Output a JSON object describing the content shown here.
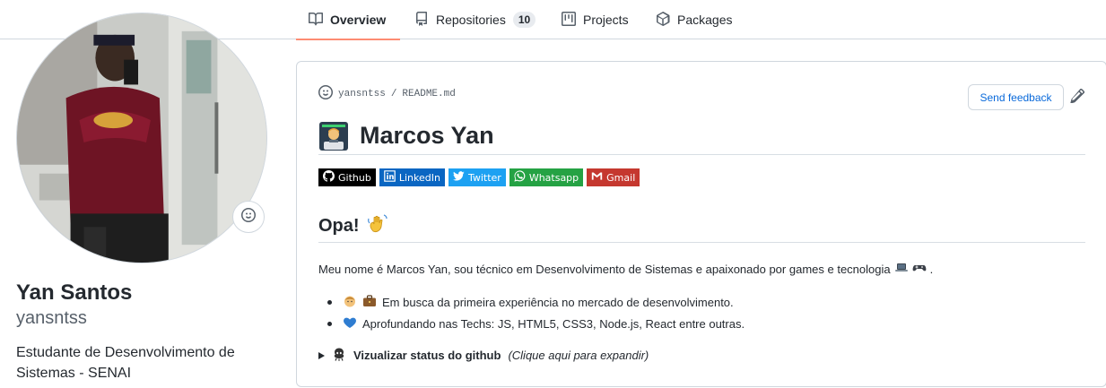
{
  "nav": {
    "tabs": [
      {
        "label": "Overview",
        "icon": "book-icon",
        "active": true
      },
      {
        "label": "Repositories",
        "icon": "repo-icon",
        "count": "10"
      },
      {
        "label": "Projects",
        "icon": "project-icon"
      },
      {
        "label": "Packages",
        "icon": "package-icon"
      }
    ]
  },
  "profile": {
    "fullname": "Yan Santos",
    "username": "yansntss",
    "bio": "Estudante de Desenvolvimento de Sistemas - SENAI"
  },
  "readme": {
    "crumb_user": "yansntss",
    "crumb_sep": "/",
    "crumb_file": "README.md",
    "feedback_label": "Send feedback",
    "title": "Marcos Yan",
    "badges": [
      {
        "label": "Github",
        "color": "#000000",
        "icon": "github-icon"
      },
      {
        "label": "LinkedIn",
        "color": "#0a66c2",
        "icon": "linkedin-icon"
      },
      {
        "label": "Twitter",
        "color": "#1da1f2",
        "icon": "twitter-icon"
      },
      {
        "label": "Whatsapp",
        "color": "#25a244",
        "icon": "whatsapp-icon"
      },
      {
        "label": "Gmail",
        "color": "#c5382f",
        "icon": "gmail-icon"
      }
    ],
    "subtitle": "Opa!",
    "intro": "Meu nome é Marcos Yan, sou técnico em Desenvolvimento de Sistemas e apaixonado por games e tecnologia",
    "intro_end": ".",
    "list": [
      "Em busca da primeira experiência no mercado de desenvolvimento.",
      "Aprofundando nas Techs: JS, HTML5, CSS3, Node.js, React entre outras."
    ],
    "details_bold": "Vizualizar status do github",
    "details_italic": "(Clique aqui para expandir)"
  },
  "colors": {
    "accent": "#fd8c73",
    "link": "#0969da",
    "border": "#d0d7de"
  }
}
